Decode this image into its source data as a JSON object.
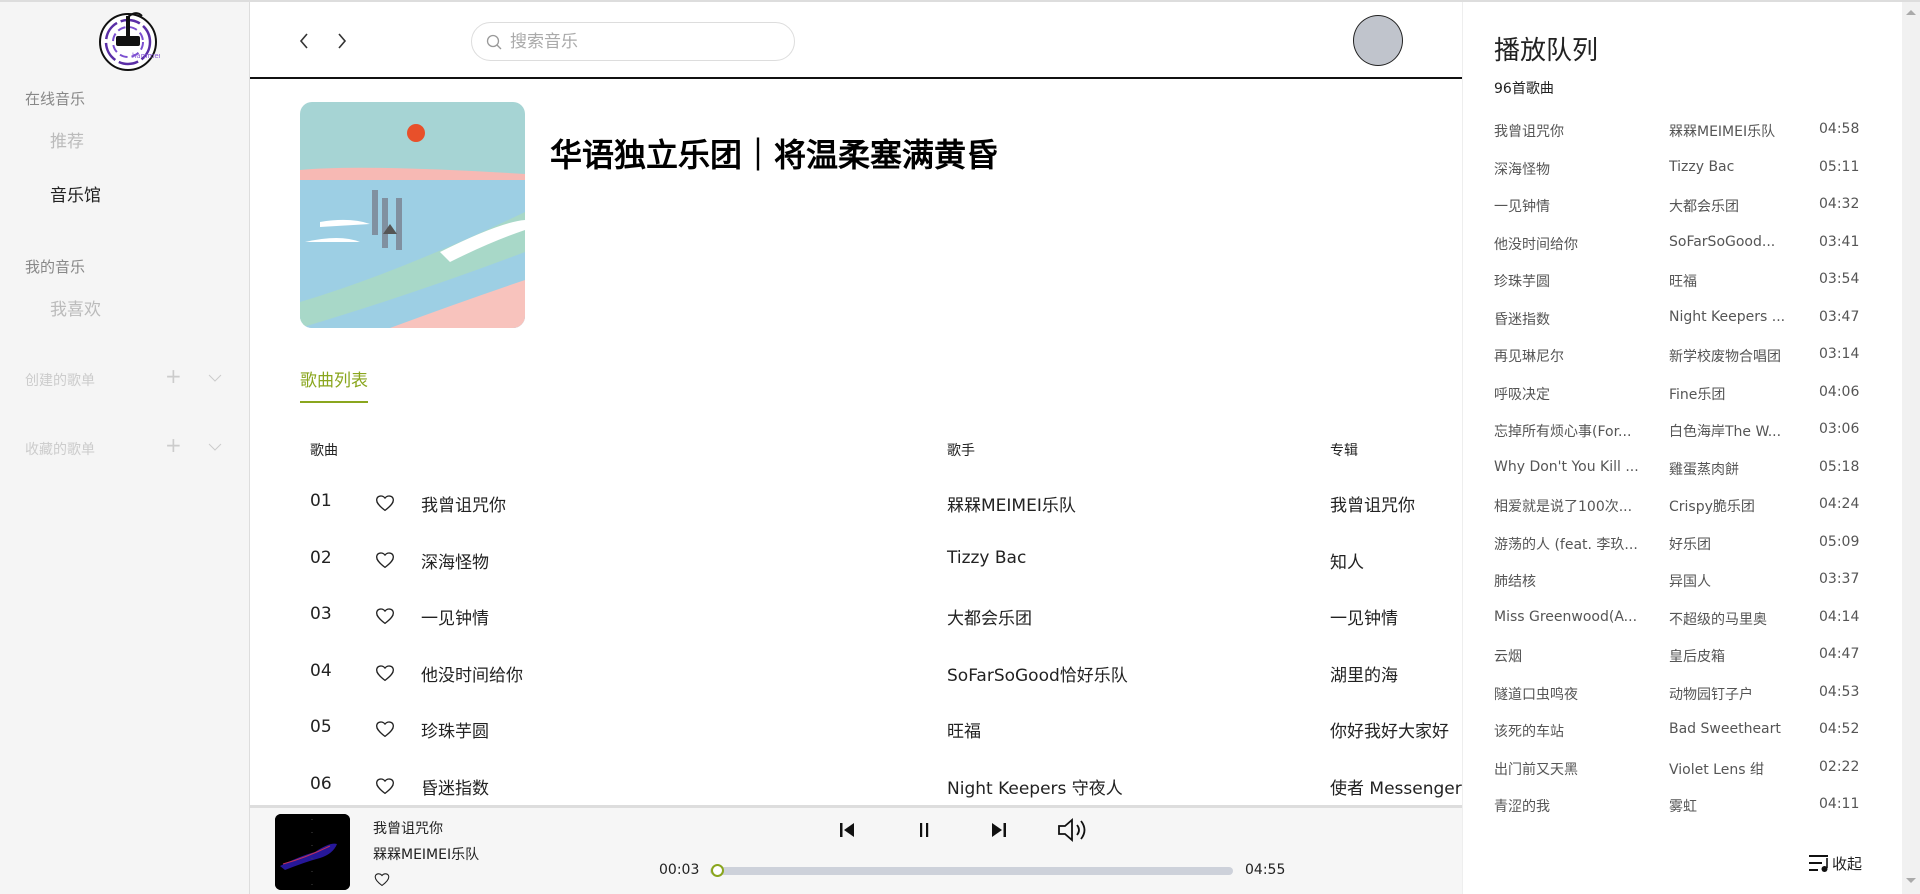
{
  "sidebar": {
    "logo_text": "hammer",
    "sections": [
      {
        "label": "在线音乐",
        "items": [
          {
            "label": "推荐",
            "active": false
          },
          {
            "label": "音乐馆",
            "active": true
          }
        ]
      },
      {
        "label": "我的音乐",
        "items": [
          {
            "label": "我喜欢",
            "active": false
          }
        ]
      }
    ],
    "playlists": [
      {
        "label": "创建的歌单"
      },
      {
        "label": "收藏的歌单"
      }
    ]
  },
  "header": {
    "search_placeholder": "搜索音乐"
  },
  "playlist": {
    "title": "华语独立乐团｜将温柔塞满黄昏",
    "tab": "歌曲列表",
    "columns": {
      "song": "歌曲",
      "artist": "歌手",
      "album": "专辑"
    },
    "rows": [
      {
        "index": "01",
        "title": "我曾诅咒你",
        "artist": "槑槑MEIMEI乐队",
        "album": "我曾诅咒你"
      },
      {
        "index": "02",
        "title": "深海怪物",
        "artist": "Tizzy Bac",
        "album": "知人"
      },
      {
        "index": "03",
        "title": "一见钟情",
        "artist": "大都会乐团",
        "album": "一见钟情"
      },
      {
        "index": "04",
        "title": "他没时间给你",
        "artist": "SoFarSoGood恰好乐队",
        "album": "湖里的海"
      },
      {
        "index": "05",
        "title": "珍珠芋圆",
        "artist": "旺福",
        "album": "你好我好大家好"
      },
      {
        "index": "06",
        "title": "昏迷指数",
        "artist": "Night Keepers 守夜人",
        "album": "使者 Messenger"
      }
    ]
  },
  "player": {
    "title": "我曾诅咒你",
    "artist": "槑槑MEIMEI乐队",
    "current": "00:03",
    "duration": "04:55",
    "progress": 0.01,
    "accent": "#8aa61e"
  },
  "queue": {
    "title": "播放队列",
    "count": "96首歌曲",
    "collapse": "收起",
    "items": [
      {
        "title": "我曾诅咒你",
        "artist": "槑槑MEIMEI乐队",
        "time": "04:58"
      },
      {
        "title": "深海怪物",
        "artist": "Tizzy Bac",
        "time": "05:11"
      },
      {
        "title": "一见钟情",
        "artist": "大都会乐团",
        "time": "04:32"
      },
      {
        "title": "他没时间给你",
        "artist": "SoFarSoGood...",
        "time": "03:41"
      },
      {
        "title": "珍珠芋圆",
        "artist": "旺福",
        "time": "03:54"
      },
      {
        "title": "昏迷指数",
        "artist": "Night Keepers ...",
        "time": "03:47"
      },
      {
        "title": "再见琳尼尔",
        "artist": "新学校废物合唱团",
        "time": "03:14"
      },
      {
        "title": "呼吸决定",
        "artist": "Fine乐团",
        "time": "04:06"
      },
      {
        "title": "忘掉所有烦心事(For...",
        "artist": "白色海岸The W...",
        "time": "03:06"
      },
      {
        "title": "Why Don't You Kill ...",
        "artist": "雞蛋蒸肉餅",
        "time": "05:18"
      },
      {
        "title": "相爱就是说了100次...",
        "artist": "Crispy脆乐团",
        "time": "04:24"
      },
      {
        "title": "游荡的人 (feat. 李玖...",
        "artist": "好乐团",
        "time": "05:09"
      },
      {
        "title": "肺结核",
        "artist": "异国人",
        "time": "03:37"
      },
      {
        "title": "Miss Greenwood(A...",
        "artist": "不超级的马里奥",
        "time": "04:14"
      },
      {
        "title": "云烟",
        "artist": "皇后皮箱",
        "time": "04:47"
      },
      {
        "title": "隧道口虫鸣夜",
        "artist": "动物园钉子户",
        "time": "04:53"
      },
      {
        "title": "该死的车站",
        "artist": "Bad Sweetheart",
        "time": "04:52"
      },
      {
        "title": "出门前又天黑",
        "artist": "Violet Lens 绀",
        "time": "02:22"
      },
      {
        "title": "青涩的我",
        "artist": "雾虹",
        "time": "04:11"
      }
    ]
  }
}
